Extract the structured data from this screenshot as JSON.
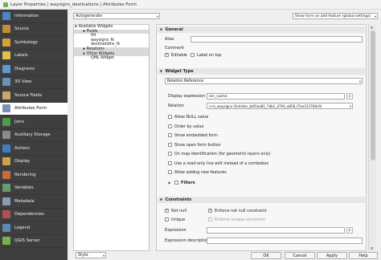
{
  "window": {
    "title": "Layer Properties | waysigns_destinations | Attributes Form"
  },
  "sidebar": {
    "items": [
      {
        "label": "Information",
        "icon": "info-icon",
        "color": "#4a86c5"
      },
      {
        "label": "Source",
        "icon": "source-icon",
        "color": "#c58a3a"
      },
      {
        "label": "Symbology",
        "icon": "symbology-icon",
        "color": "#d4a23b"
      },
      {
        "label": "Labels",
        "icon": "labels-icon",
        "color": "#e2c14b"
      },
      {
        "label": "Diagrams",
        "icon": "diagrams-icon",
        "color": "#5a9bd5"
      },
      {
        "label": "3D View",
        "icon": "3d-view-icon",
        "color": "#6b8fb8"
      },
      {
        "label": "Source Fields",
        "icon": "source-fields-icon",
        "color": "#c9a66b"
      },
      {
        "label": "Attributes Form",
        "icon": "attributes-form-icon",
        "color": "#7a93b0"
      },
      {
        "label": "Joins",
        "icon": "joins-icon",
        "color": "#4f9a4f"
      },
      {
        "label": "Auxiliary Storage",
        "icon": "auxiliary-storage-icon",
        "color": "#8a8a8a"
      },
      {
        "label": "Actions",
        "icon": "actions-icon",
        "color": "#3f7fc0"
      },
      {
        "label": "Display",
        "icon": "display-icon",
        "color": "#d0a050"
      },
      {
        "label": "Rendering",
        "icon": "rendering-icon",
        "color": "#c86a3c"
      },
      {
        "label": "Variables",
        "icon": "variables-icon",
        "color": "#6a9a6a"
      },
      {
        "label": "Metadata",
        "icon": "metadata-icon",
        "color": "#8a9ab0"
      },
      {
        "label": "Dependencies",
        "icon": "dependencies-icon",
        "color": "#b05050"
      },
      {
        "label": "Legend",
        "icon": "legend-icon",
        "color": "#5a8ab0"
      },
      {
        "label": "QGIS Server",
        "icon": "qgis-server-icon",
        "color": "#7ab04a"
      }
    ],
    "active_index": 7
  },
  "topbar": {
    "layout_mode": "Autogenerate",
    "show_form": "Show form on add feature (global settings)"
  },
  "tree": {
    "rows": [
      {
        "label": "Available Widgets",
        "level": 0,
        "hl": false
      },
      {
        "label": "Fields",
        "level": 1,
        "hl": true
      },
      {
        "label": "fid",
        "level": 2,
        "hl": false
      },
      {
        "label": "waysigns_fk",
        "level": 2,
        "hl": false
      },
      {
        "label": "destinations_fk",
        "level": 2,
        "hl": false
      },
      {
        "label": "Relations",
        "level": 1,
        "hl": true
      },
      {
        "label": "Other Widgets",
        "level": 1,
        "hl": true
      },
      {
        "label": "QML Widget",
        "level": 2,
        "hl": false
      }
    ]
  },
  "general": {
    "header": "General",
    "alias_label": "Alias",
    "alias_value": "",
    "comment_label": "Comment",
    "editable_label": "Editable",
    "editable_checked": true,
    "label_on_top_label": "Label on top",
    "label_on_top_checked": false
  },
  "widget_type": {
    "header": "Widget Type",
    "type_value": "Relation Reference",
    "display_expression_label": "Display expression",
    "display_expression_value": "ein_name",
    "relation_label": "Relation",
    "relation_value": "n-m_waysigns (Schilder_bdf1aa81_7db1_4794_a858_f7ae123768c9)",
    "options": [
      {
        "label": "Allow NULL value",
        "checked": false
      },
      {
        "label": "Order by value",
        "checked": false
      },
      {
        "label": "Show embedded form",
        "checked": false
      },
      {
        "label": "Show open form button",
        "checked": false
      },
      {
        "label": "On map identification (for geometric layers only)",
        "checked": false
      },
      {
        "label": "Use a read-only line edit instead of a combobox",
        "checked": false
      },
      {
        "label": "Allow adding new features",
        "checked": false
      }
    ],
    "filters_label": "Filters"
  },
  "constraints": {
    "header": "Constraints",
    "not_null_label": "Not null",
    "not_null_checked": true,
    "enforce_not_null_label": "Enforce not null constraint",
    "enforce_not_null_checked": true,
    "unique_label": "Unique",
    "unique_checked": false,
    "enforce_unique_label": "Enforce unique constraint",
    "enforce_unique_checked": false,
    "expression_label": "Expression",
    "expression_value": "",
    "expression_desc_label": "Expression description",
    "expression_desc_value": ""
  },
  "bottom": {
    "style_label": "Style",
    "ok_label": "OK",
    "cancel_label": "Cancel",
    "apply_label": "Apply",
    "help_label": "Help"
  },
  "glyphs": {
    "chevron": "▾",
    "check": "✓",
    "triangle_right": "▶",
    "triangle_down": "▼",
    "scroll_up": "▲",
    "scroll_down": "▼",
    "ellipsis": "…",
    "epsilon": "ε",
    "refresh": "↺"
  }
}
